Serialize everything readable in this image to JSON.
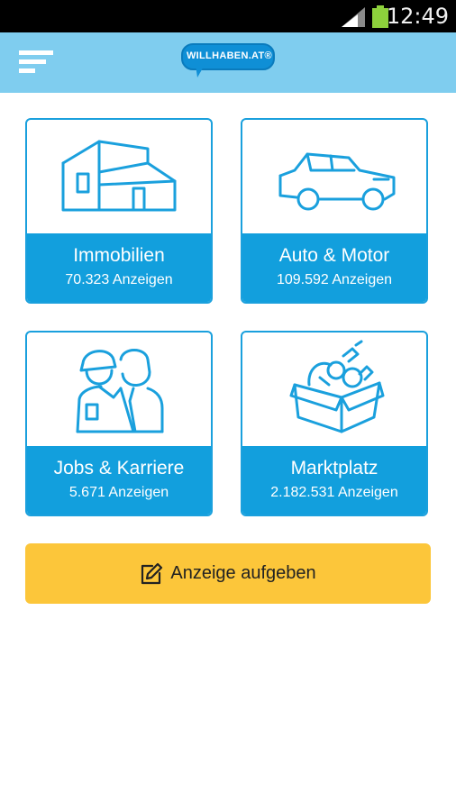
{
  "status_bar": {
    "time": "12:49"
  },
  "app_bar": {
    "logo_text": "WILLHABEN.AT®"
  },
  "categories": [
    {
      "title": "Immobilien",
      "count": "70.323 Anzeigen",
      "icon": "house-icon"
    },
    {
      "title": "Auto & Motor",
      "count": "109.592 Anzeigen",
      "icon": "car-icon"
    },
    {
      "title": "Jobs & Karriere",
      "count": "5.671 Anzeigen",
      "icon": "workers-icon"
    },
    {
      "title": "Marktplatz",
      "count": "2.182.531 Anzeigen",
      "icon": "box-icon"
    }
  ],
  "cta": {
    "label": "Anzeige aufgeben",
    "icon": "edit-icon"
  },
  "colors": {
    "app_bar": "#7fcdef",
    "tile_accent": "#129fdd",
    "cta": "#fcc63a",
    "status_bar": "#000000"
  }
}
